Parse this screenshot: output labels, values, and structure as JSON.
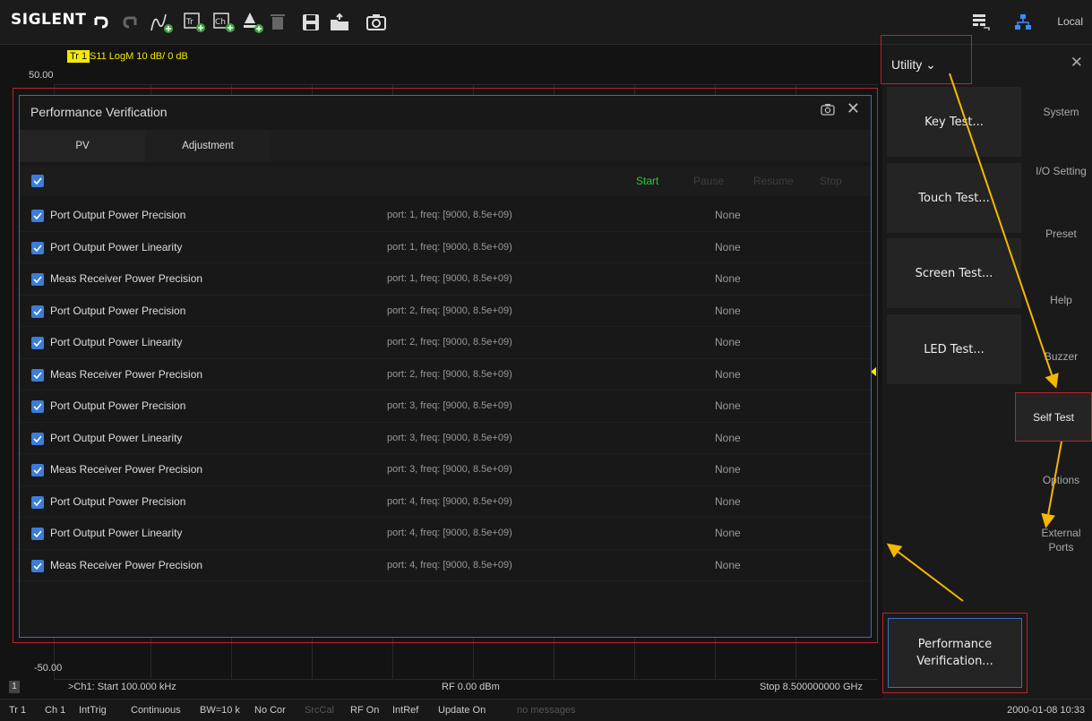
{
  "toolbar": {
    "logo": "SIGLENT",
    "icons": [
      "undo-icon",
      "redo-icon",
      "add-trace-icon",
      "add-tr-icon",
      "add-ch-icon",
      "add-marker-icon",
      "delete-icon",
      "save-icon",
      "open-file-icon",
      "camera-icon",
      "keyboard-icon",
      "network-icon"
    ],
    "local_label": "Local"
  },
  "trace": {
    "tag": "Tr 1",
    "info": "S11 LogM 10 dB/ 0 dB",
    "y_top": "50.00",
    "y_bottom": "-50.00",
    "channel_num": "1",
    "start": ">Ch1: Start 100.000 kHz",
    "rf": "RF 0.00 dBm",
    "stop": "Stop 8.500000000 GHz"
  },
  "dialog": {
    "title": "Performance Verification",
    "tabs": [
      "PV",
      "Adjustment"
    ],
    "controls": {
      "start": "Start",
      "pause": "Pause",
      "resume": "Resume",
      "stop": "Stop"
    },
    "rows": [
      {
        "name": "Port Output Power Precision",
        "param": "port: 1, freq: [9000, 8.5e+09)",
        "result": "None"
      },
      {
        "name": "Port Output Power Linearity",
        "param": "port: 1, freq: [9000, 8.5e+09)",
        "result": "None"
      },
      {
        "name": "Meas Receiver Power Precision",
        "param": "port: 1, freq: [9000, 8.5e+09)",
        "result": "None"
      },
      {
        "name": "Port Output Power Precision",
        "param": "port: 2, freq: [9000, 8.5e+09)",
        "result": "None"
      },
      {
        "name": "Port Output Power Linearity",
        "param": "port: 2, freq: [9000, 8.5e+09)",
        "result": "None"
      },
      {
        "name": "Meas Receiver Power Precision",
        "param": "port: 2, freq: [9000, 8.5e+09)",
        "result": "None"
      },
      {
        "name": "Port Output Power Precision",
        "param": "port: 3, freq: [9000, 8.5e+09)",
        "result": "None"
      },
      {
        "name": "Port Output Power Linearity",
        "param": "port: 3, freq: [9000, 8.5e+09)",
        "result": "None"
      },
      {
        "name": "Meas Receiver Power Precision",
        "param": "port: 3, freq: [9000, 8.5e+09)",
        "result": "None"
      },
      {
        "name": "Port Output Power Precision",
        "param": "port: 4, freq: [9000, 8.5e+09)",
        "result": "None"
      },
      {
        "name": "Port Output Power Linearity",
        "param": "port: 4, freq: [9000, 8.5e+09)",
        "result": "None"
      },
      {
        "name": "Meas Receiver Power Precision",
        "param": "port: 4, freq: [9000, 8.5e+09)",
        "result": "None"
      }
    ]
  },
  "panel": {
    "title": "Utility ⌄",
    "buttons": [
      "Key Test...",
      "Touch Test...",
      "Screen Test...",
      "LED Test..."
    ],
    "side": [
      "System",
      "I/O Setting",
      "Preset",
      "Help",
      "Buzzer",
      "Options"
    ],
    "side_external": {
      "line1": "External",
      "line2": "Ports"
    },
    "selected": "Self Test",
    "pv": {
      "line1": "Performance",
      "line2": "Verification..."
    }
  },
  "status": {
    "items": [
      "Tr 1",
      "Ch 1",
      "IntTrig",
      "Continuous",
      "BW=10 k",
      "No Cor",
      "SrcCal",
      "RF On",
      "IntRef",
      "Update On",
      "no messages"
    ],
    "time": "2000-01-08 10:33"
  },
  "colors": {
    "accent_blue": "#3b7dd8",
    "highlight_red": "#c0232b",
    "arrow_yellow": "#f5b700",
    "start_green": "#27c93f",
    "trace_yellow": "#f2ea00"
  }
}
